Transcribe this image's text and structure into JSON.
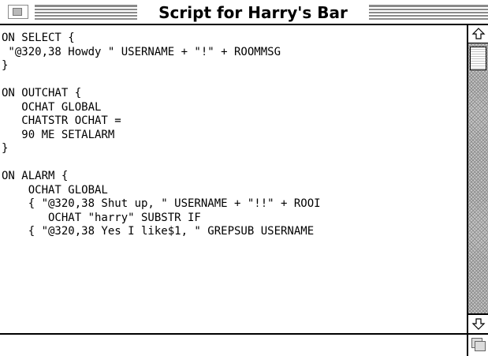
{
  "window": {
    "title": "Script for Harry's Bar"
  },
  "script": {
    "lines": [
      "ON SELECT {",
      " \"@320,38 Howdy \" USERNAME + \"!\" + ROOMMSG",
      "}",
      "",
      "ON OUTCHAT {",
      "   OCHAT GLOBAL",
      "   CHATSTR OCHAT =",
      "   90 ME SETALARM",
      "}",
      "",
      "ON ALARM {",
      "    OCHAT GLOBAL",
      "    { \"@320,38 Shut up, \" USERNAME + \"!!\" + ROOI",
      "       OCHAT \"harry\" SUBSTR IF",
      "    { \"@320,38 Yes I like$1, \" GREPSUB USERNAME"
    ]
  },
  "icons": {
    "close": "close-box-icon",
    "up": "up-arrow-icon",
    "down": "down-arrow-icon",
    "grow": "grow-box-icon"
  },
  "colors": {
    "background": "#ffffff",
    "stripes": "#8a8a8a",
    "scroll_track": "#c9c9c9"
  }
}
